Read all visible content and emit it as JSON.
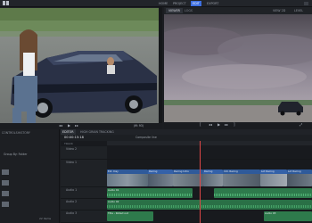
{
  "workspaces": [
    {
      "label": "HOME",
      "active": false
    },
    {
      "label": "PROJECT",
      "active": false
    },
    {
      "label": "EDIT",
      "active": true
    },
    {
      "label": "EXPORT",
      "active": false
    }
  ],
  "viewer": {
    "tabs": [
      {
        "label": "VIEWER",
        "active": true
      },
      {
        "label": "LOGS",
        "active": false
      }
    ],
    "view_label": "VIEW 2D",
    "level_label": "LEVEL"
  },
  "media": {
    "zoom_label": "(fit 93)"
  },
  "left_panel": {
    "tabs": [
      "CONTROLS",
      "HISTORY"
    ],
    "group_label": "Group By: Folder",
    "count_label": "22 items"
  },
  "timeline": {
    "tabs": [
      {
        "label": "EDITOR",
        "active": true
      },
      {
        "label": "HIGH GRAIN TRACKING",
        "active": false
      }
    ],
    "timecode": "00:00:15:18",
    "composite_label": "Composite line",
    "video_tracks": [
      {
        "name": "Video 2"
      },
      {
        "name": "Video 1"
      }
    ],
    "audio_tracks": [
      {
        "name": "Audio 1"
      },
      {
        "name": "Audio 2"
      },
      {
        "name": "Audio 3"
      }
    ],
    "track_header": "TRACK",
    "clip_labels": [
      "Ext. Day",
      "Racing",
      "Racing Intro",
      "Racing",
      "Intr. Racing",
      "Lot Racing",
      "Lot Racing",
      "Audio 01",
      "Audio 02",
      "Title - Rolled out",
      "Audio 03"
    ]
  }
}
